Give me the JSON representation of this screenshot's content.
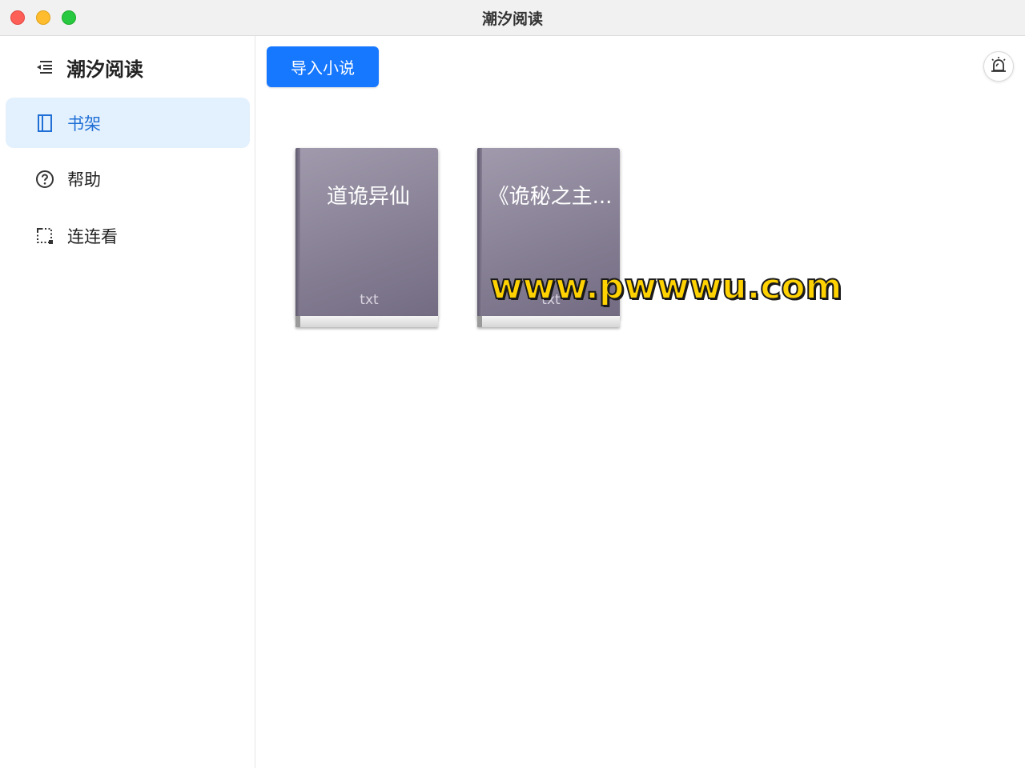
{
  "window": {
    "title": "潮汐阅读"
  },
  "sidebar": {
    "app_name": "潮汐阅读",
    "items": [
      {
        "label": "书架",
        "icon": "book-icon",
        "active": true
      },
      {
        "label": "帮助",
        "icon": "help-circle-icon",
        "active": false
      },
      {
        "label": "连连看",
        "icon": "crop-frame-icon",
        "active": false
      }
    ]
  },
  "toolbar": {
    "import_label": "导入小说",
    "alarm_icon": "alarm-icon"
  },
  "books": [
    {
      "title": "道诡异仙",
      "format": "txt"
    },
    {
      "title": "《诡秘之主...",
      "format": "txt"
    }
  ],
  "watermark": {
    "text": "www.pwwwu.com"
  },
  "colors": {
    "accent": "#1677ff",
    "active_nav_bg": "#e3f0fd",
    "active_nav_text": "#1f6fd6",
    "book_cover": "#8c8599"
  }
}
